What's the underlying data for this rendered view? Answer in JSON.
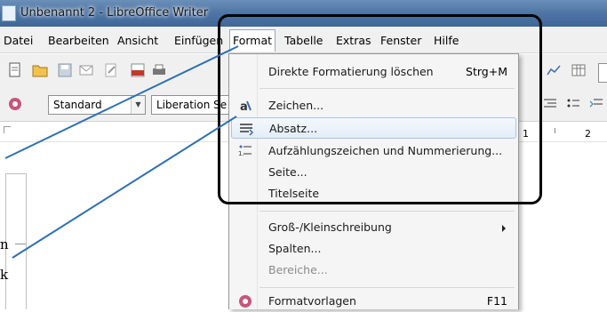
{
  "window": {
    "title": "Unbenannt 2 - LibreOffice Writer"
  },
  "menubar": {
    "items": [
      {
        "label": "Datei"
      },
      {
        "label": "Bearbeiten"
      },
      {
        "label": "Ansicht"
      },
      {
        "label": "Einfügen"
      },
      {
        "label": "Format"
      },
      {
        "label": "Tabelle"
      },
      {
        "label": "Extras"
      },
      {
        "label": "Fenster"
      },
      {
        "label": "Hilfe"
      }
    ]
  },
  "toolbar": {
    "paragraph_style": "Standard",
    "font_name": "Liberation Se"
  },
  "ruler": {
    "labels": [
      "1",
      "2"
    ]
  },
  "format_menu": {
    "items": [
      {
        "label": "Direkte Formatierung löschen",
        "shortcut": "Strg+M"
      },
      {
        "label": "Zeichen...",
        "icon": "character-icon"
      },
      {
        "label": "Absatz...",
        "icon": "paragraph-icon"
      },
      {
        "label": "Aufzählungszeichen und Nummerierung...",
        "icon": "bullets-numbering-icon"
      },
      {
        "label": "Seite..."
      },
      {
        "label": "Titelseite"
      },
      {
        "label": "Groß-/Kleinschreibung"
      },
      {
        "label": "Spalten..."
      },
      {
        "label": "Bereiche..."
      },
      {
        "label": "Formatvorlagen",
        "shortcut": "F11",
        "icon": "styles-icon"
      }
    ]
  },
  "annotations": {
    "text1": "n",
    "text2": "k"
  },
  "colors": {
    "title_gradient": "#4d74a3",
    "highlight_border": "#a9c6e6",
    "callout_line": "#2e6fb4"
  }
}
